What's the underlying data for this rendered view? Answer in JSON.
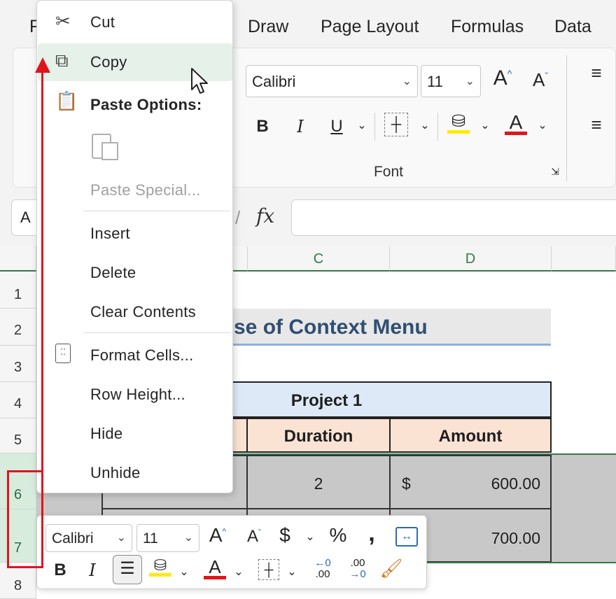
{
  "ribbon": {
    "tabs": [
      "F",
      "Draw",
      "Page Layout",
      "Formulas",
      "Data"
    ],
    "font_name": "Calibri",
    "font_size": "11",
    "group_label": "Font",
    "bold": "B",
    "italic": "I",
    "underline": "U",
    "grow_font": "A",
    "shrink_font": "A",
    "font_color_letter": "A",
    "fill_highlight_color": "#ffeb00",
    "font_color": "#e1141c"
  },
  "formula_bar": {
    "name_box": "A",
    "fx": "fx",
    "value": ""
  },
  "columns": [
    "C",
    "D"
  ],
  "rows": [
    "1",
    "2",
    "3",
    "4",
    "5",
    "6",
    "7",
    "8"
  ],
  "sheet": {
    "title": "se of Context Menu",
    "project": "Project 1",
    "headers": [
      "Duration",
      "Amount"
    ],
    "row6": {
      "duration": "2",
      "currency": "$",
      "amount": "600.00"
    },
    "row7": {
      "amount": "700.00"
    }
  },
  "context_menu": {
    "cut": "Cut",
    "copy": "Copy",
    "paste_options": "Paste Options:",
    "paste_special": "Paste Special...",
    "insert": "Insert",
    "delete": "Delete",
    "clear_contents": "Clear Contents",
    "format_cells": "Format Cells...",
    "row_height": "Row Height...",
    "hide": "Hide",
    "unhide": "Unhide"
  },
  "mini_toolbar": {
    "font_name": "Calibri",
    "font_size": "11",
    "currency": "$",
    "percent": "%",
    "comma": ",",
    "bold": "B",
    "italic": "I",
    "font_color_letter": "A",
    "inc_decimal_top": "←0",
    "inc_decimal_bottom": ".00",
    "dec_decimal_top": ".00",
    "dec_decimal_bottom": "→0"
  }
}
